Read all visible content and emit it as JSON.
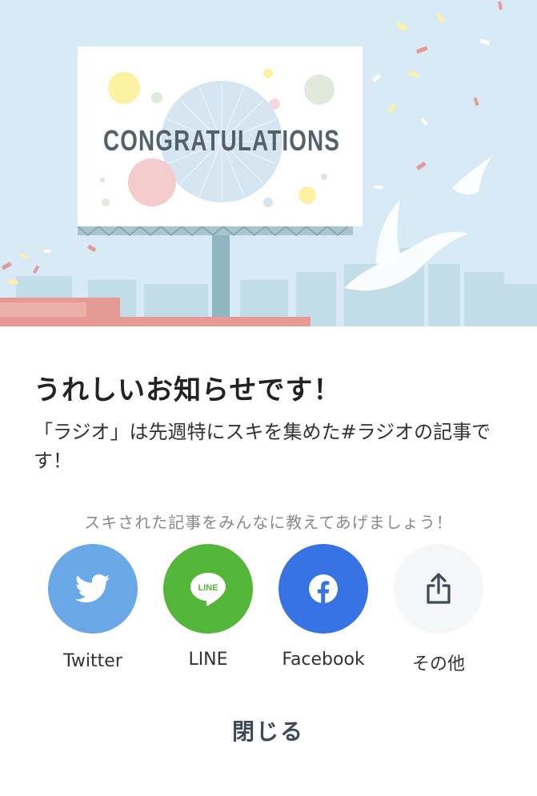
{
  "hero": {
    "billboard_text": "CONGRATULATIONS"
  },
  "dialog": {
    "title": "うれしいお知らせです！",
    "message": "「ラジオ」は先週特にスキを集めた#ラジオの記事です！",
    "share_prompt": "スキされた記事をみんなに教えてあげましょう！",
    "close_label": "閉じる"
  },
  "share": {
    "twitter": {
      "label": "Twitter",
      "color": "#6aa8e8",
      "icon": "twitter-bird-icon"
    },
    "line": {
      "label": "LINE",
      "color": "#54b639",
      "icon": "line-icon",
      "icon_text": "LINE"
    },
    "facebook": {
      "label": "Facebook",
      "color": "#3873e5",
      "icon": "facebook-icon"
    },
    "other": {
      "label": "その他",
      "color": "#f4f6f7",
      "icon": "share-icon"
    }
  }
}
